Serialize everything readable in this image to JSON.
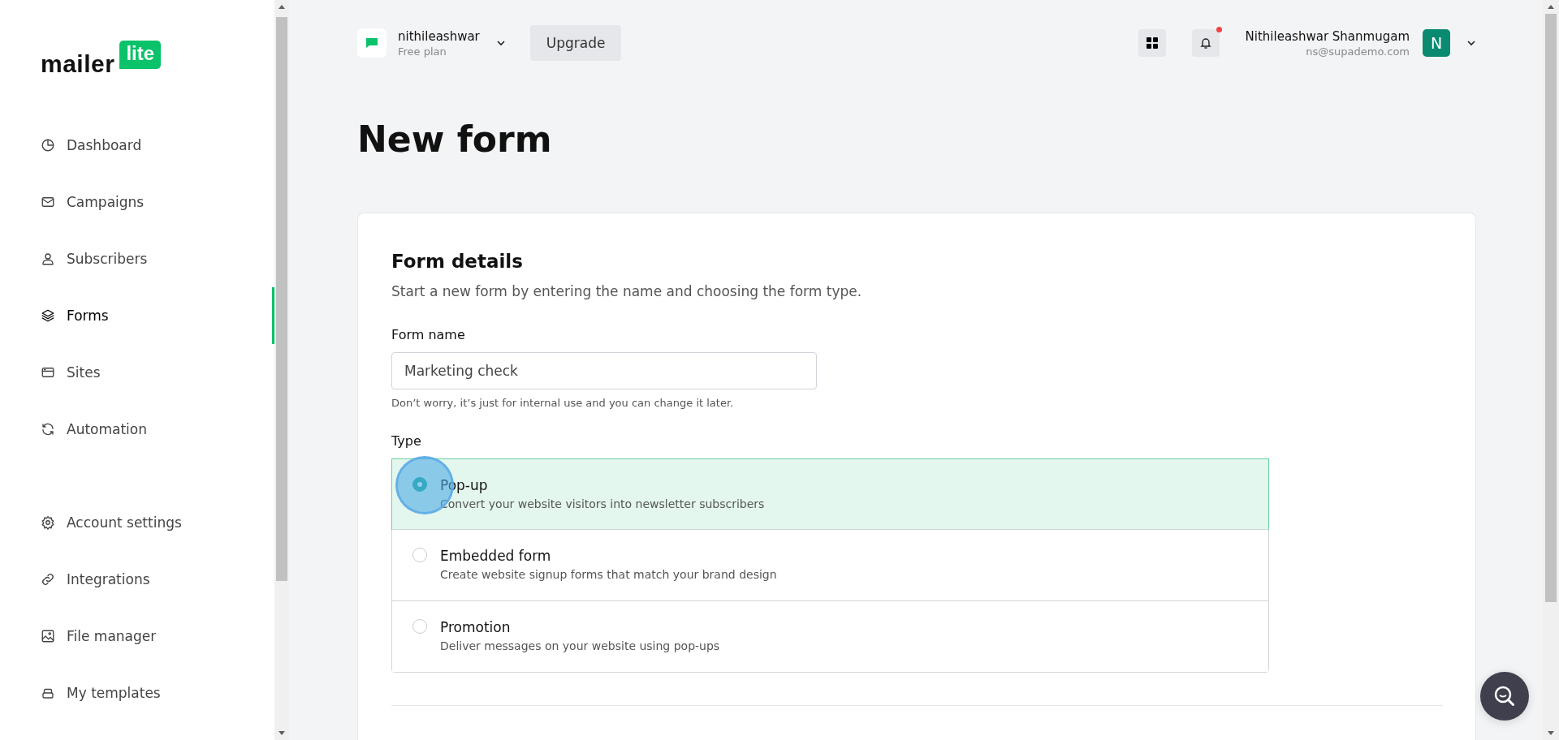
{
  "logo": {
    "word": "mailer",
    "badge": "lite"
  },
  "sidebar": {
    "items": [
      {
        "label": "Dashboard",
        "selected": false
      },
      {
        "label": "Campaigns",
        "selected": false
      },
      {
        "label": "Subscribers",
        "selected": false
      },
      {
        "label": "Forms",
        "selected": true
      },
      {
        "label": "Sites",
        "selected": false
      },
      {
        "label": "Automation",
        "selected": false
      }
    ],
    "secondary_items": [
      {
        "label": "Account settings",
        "selected": false
      },
      {
        "label": "Integrations",
        "selected": false
      },
      {
        "label": "File manager",
        "selected": false
      },
      {
        "label": "My templates",
        "selected": false
      }
    ]
  },
  "header": {
    "account": {
      "name": "nithileashwar",
      "plan": "Free plan"
    },
    "upgrade_button": "Upgrade",
    "notifications": {
      "unread": true
    },
    "user": {
      "name": "Nithileashwar Shanmugam",
      "email": "ns@supademo.com",
      "initial": "N"
    }
  },
  "page": {
    "title": "New form"
  },
  "form": {
    "heading": "Form details",
    "description": "Start a new form by entering the name and choosing the form type.",
    "name_field": {
      "label": "Form name",
      "value": "Marketing check",
      "hint": "Don’t worry, it’s just for internal use and you can change it later."
    },
    "type_label": "Type",
    "types": [
      {
        "title": "Pop-up",
        "description": "Convert your website visitors into newsletter subscribers",
        "selected": true
      },
      {
        "title": "Embedded form",
        "description": "Create website signup forms that match your brand design",
        "selected": false
      },
      {
        "title": "Promotion",
        "description": "Deliver messages on your website using pop-ups",
        "selected": false
      }
    ]
  }
}
